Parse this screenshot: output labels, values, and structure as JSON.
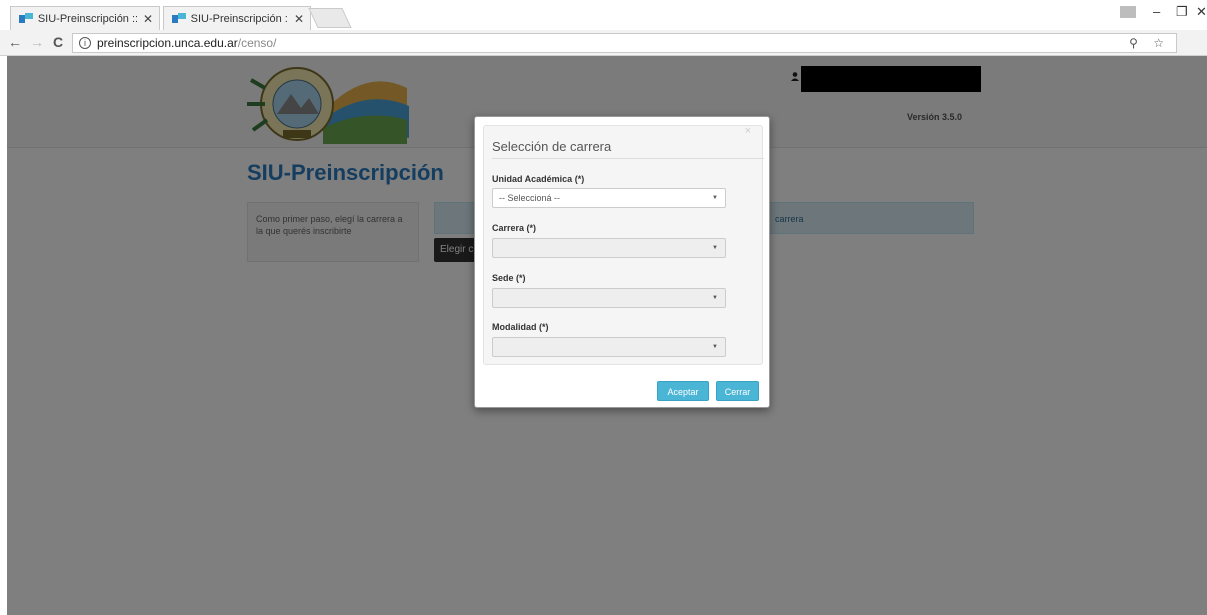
{
  "browser": {
    "tabs": [
      {
        "title": "SIU-Preinscripción :: Carg",
        "close": "✕"
      },
      {
        "title": "SIU-Preinscripción :: Carg",
        "close": "✕"
      }
    ],
    "url_host": "preinscripcion.unca.edu.ar",
    "url_path": "/censo/",
    "nav": {
      "back": "←",
      "forward": "→",
      "reload": "C"
    },
    "window": {
      "minimize": "–",
      "restore": "❐",
      "close": "✕"
    },
    "tools": "⚲ ☆"
  },
  "header": {
    "version": "Versión 3.5.0"
  },
  "main": {
    "app_title": "SIU-Preinscripción",
    "help_text": "Como primer paso, elegí la carrera a la que querés inscribirte",
    "info_bar_text": "carrera",
    "choose_button": "Elegir c"
  },
  "modal": {
    "title": "Selección de carrera",
    "close": "×",
    "fields": [
      {
        "label": "Unidad Académica (*)",
        "value": "-- Seleccioná --",
        "disabled": false
      },
      {
        "label": "Carrera (*)",
        "value": "",
        "disabled": true
      },
      {
        "label": "Sede (*)",
        "value": "",
        "disabled": true
      },
      {
        "label": "Modalidad (*)",
        "value": "",
        "disabled": true
      }
    ],
    "accept_label": "Aceptar",
    "close_label": "Cerrar"
  },
  "colors": {
    "title_blue": "#2a7bbf",
    "button_blue": "#4bb5d6",
    "info_bg": "#d9edf7"
  }
}
